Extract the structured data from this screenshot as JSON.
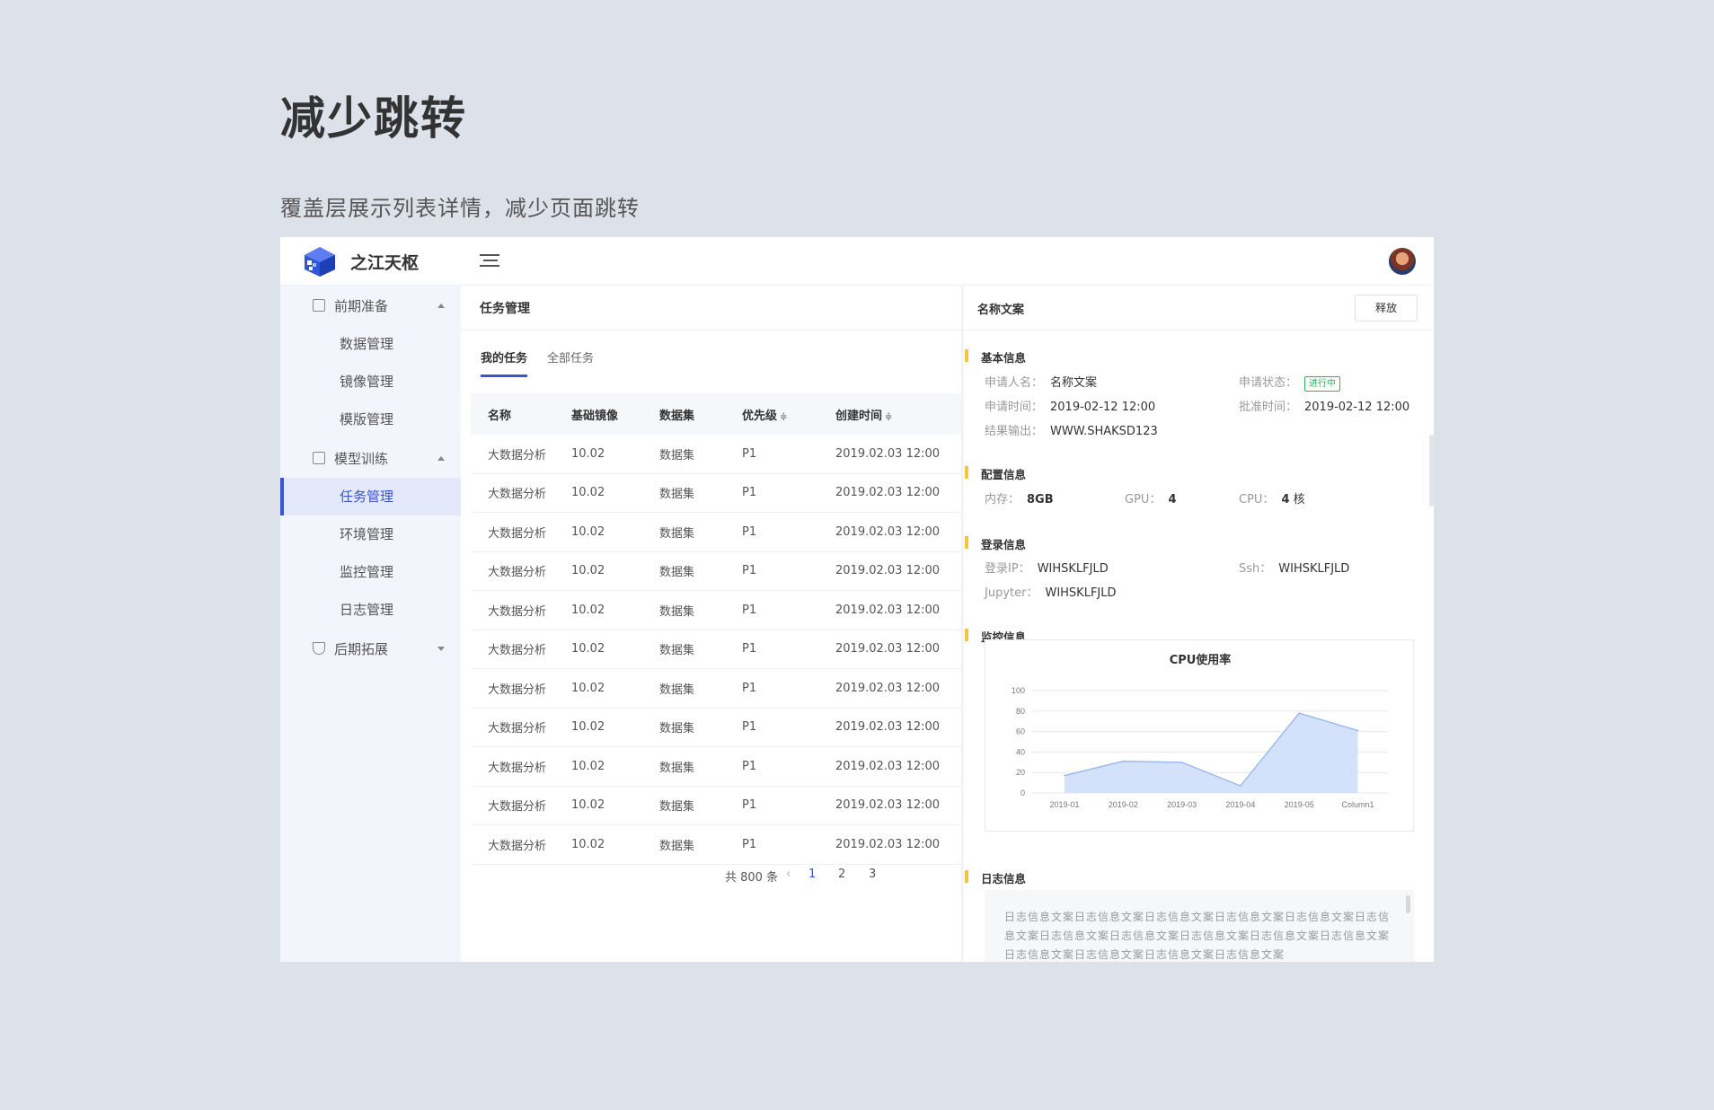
{
  "hero": {
    "title": "减少跳转",
    "subtitle": "覆盖层展示列表详情，减少页面跳转"
  },
  "app": {
    "brand": "之江天枢",
    "icons": {
      "menu": "menu-toggle-icon",
      "logo": "cube-logo-icon",
      "avatar": "user-avatar"
    },
    "accent": "#3a55d4"
  },
  "sidebar": {
    "groups": [
      {
        "label": "前期准备",
        "icon": "copy-icon",
        "expanded": true,
        "items": [
          "数据管理",
          "镜像管理",
          "模版管理"
        ]
      },
      {
        "label": "模型训练",
        "icon": "document-search-icon",
        "expanded": true,
        "items": [
          "任务管理",
          "环境管理",
          "监控管理",
          "日志管理"
        ]
      },
      {
        "label": "后期拓展",
        "icon": "shield-check-icon",
        "expanded": false,
        "items": []
      }
    ],
    "active_item": "任务管理"
  },
  "main": {
    "title": "任务管理",
    "tabs": [
      {
        "label": "我的任务",
        "active": true
      },
      {
        "label": "全部任务",
        "active": false
      }
    ],
    "columns": [
      "名称",
      "基础镜像",
      "数据集",
      "优先级",
      "创建时间"
    ],
    "sortable_marker": "≑",
    "rows": [
      [
        "大数据分析",
        "10.02",
        "数据集",
        "P1",
        "2019.02.03 12:00"
      ],
      [
        "大数据分析",
        "10.02",
        "数据集",
        "P1",
        "2019.02.03 12:00"
      ],
      [
        "大数据分析",
        "10.02",
        "数据集",
        "P1",
        "2019.02.03 12:00"
      ],
      [
        "大数据分析",
        "10.02",
        "数据集",
        "P1",
        "2019.02.03 12:00"
      ],
      [
        "大数据分析",
        "10.02",
        "数据集",
        "P1",
        "2019.02.03 12:00"
      ],
      [
        "大数据分析",
        "10.02",
        "数据集",
        "P1",
        "2019.02.03 12:00"
      ],
      [
        "大数据分析",
        "10.02",
        "数据集",
        "P1",
        "2019.02.03 12:00"
      ],
      [
        "大数据分析",
        "10.02",
        "数据集",
        "P1",
        "2019.02.03 12:00"
      ],
      [
        "大数据分析",
        "10.02",
        "数据集",
        "P1",
        "2019.02.03 12:00"
      ],
      [
        "大数据分析",
        "10.02",
        "数据集",
        "P1",
        "2019.02.03 12:00"
      ],
      [
        "大数据分析",
        "10.02",
        "数据集",
        "P1",
        "2019.02.03 12:00"
      ]
    ],
    "pagination": {
      "total": "共 800 条",
      "prev": "‹",
      "pages": [
        "1",
        "2",
        "3"
      ],
      "current": "1"
    }
  },
  "detail": {
    "title": "名称文案",
    "release_label": "释放",
    "basic": {
      "title": "基本信息",
      "applicant_k": "申请人名：",
      "applicant_v": "名称文案",
      "status_k": "申请状态：",
      "status_v": "进行中",
      "apply_time_k": "申请时间：",
      "apply_time_v": "2019-02-12 12:00",
      "approve_time_k": "批准时间：",
      "approve_time_v": "2019-02-12 12:00",
      "output_k": "结果输出：",
      "output_v": "WWW.SHAKSD123"
    },
    "config": {
      "title": "配置信息",
      "mem_k": "内存：",
      "mem_v": "8GB",
      "gpu_k": "GPU：",
      "gpu_v": "4",
      "cpu_k": "CPU：",
      "cpu_v": "4",
      "cpu_unit": "核"
    },
    "login": {
      "title": "登录信息",
      "ip_k": "登录IP：",
      "ip_v": "WIHSKLFJLD",
      "ssh_k": "Ssh：",
      "ssh_v": "WIHSKLFJLD",
      "jupyter_k": "Jupyter：",
      "jupyter_v": "WIHSKLFJLD"
    },
    "monitor": {
      "title": "监控信息"
    },
    "log": {
      "title": "日志信息",
      "text": "日志信息文案日志信息文案日志信息文案日志信息文案日志信息文案日志信息文案日志信息文案日志信息文案日志信息文案日志信息文案日志信息文案日志信息文案日志信息文案日志信息文案日志信息文案"
    }
  },
  "chart_data": {
    "type": "area",
    "title": "CPU使用率",
    "categories": [
      "2019-01",
      "2019-02",
      "2019-03",
      "2019-04",
      "2019-05",
      "Column1"
    ],
    "series": [
      {
        "values": [
          17,
          31,
          30,
          7,
          78,
          61
        ]
      }
    ],
    "ylim": [
      0,
      100
    ],
    "yticks": [
      0,
      20,
      40,
      60,
      80,
      100
    ],
    "grid": true,
    "colors": {
      "fill": "#d3e1fb",
      "line": "#8fb0ee"
    }
  }
}
